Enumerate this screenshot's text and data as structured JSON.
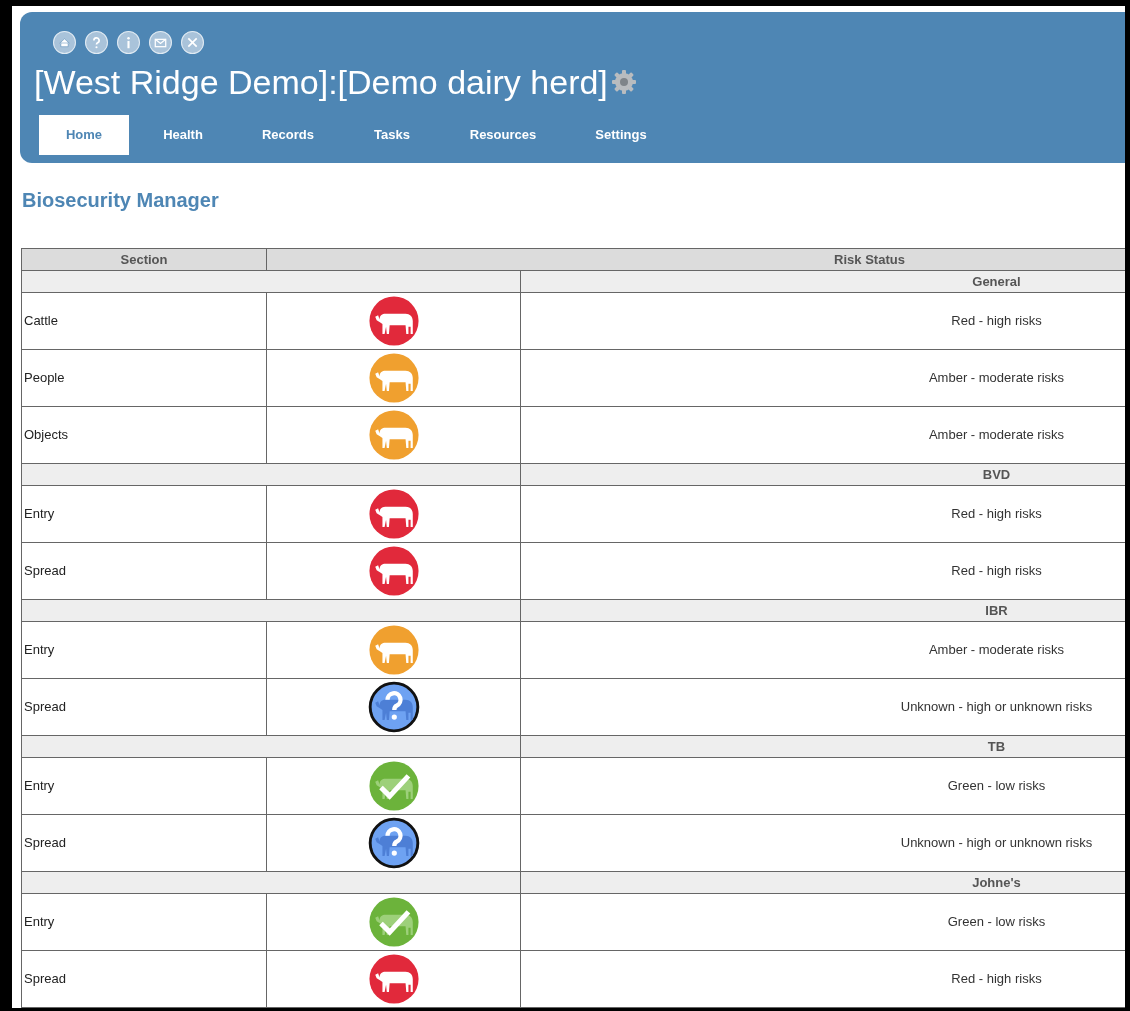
{
  "header": {
    "title": "[West Ridge Demo]:[Demo dairy herd]",
    "tabs": [
      {
        "label": "Home",
        "selected": true
      },
      {
        "label": "Health",
        "selected": false
      },
      {
        "label": "Records",
        "selected": false
      },
      {
        "label": "Tasks",
        "selected": false
      },
      {
        "label": "Resources",
        "selected": false
      },
      {
        "label": "Settings",
        "selected": false
      }
    ]
  },
  "page_title": "Biosecurity Manager",
  "table": {
    "columns": [
      "Section",
      "Risk Status"
    ],
    "groups": [
      {
        "title": "General",
        "rows": [
          {
            "section": "Cattle",
            "kind": "red",
            "status": "Red - high risks"
          },
          {
            "section": "People",
            "kind": "amber",
            "status": "Amber - moderate risks"
          },
          {
            "section": "Objects",
            "kind": "amber",
            "status": "Amber - moderate risks"
          }
        ]
      },
      {
        "title": "BVD",
        "rows": [
          {
            "section": "Entry",
            "kind": "red",
            "status": "Red - high risks"
          },
          {
            "section": "Spread",
            "kind": "red",
            "status": "Red - high risks"
          }
        ]
      },
      {
        "title": "IBR",
        "rows": [
          {
            "section": "Entry",
            "kind": "amber",
            "status": "Amber - moderate risks"
          },
          {
            "section": "Spread",
            "kind": "unknown",
            "status": "Unknown - high or unknown risks"
          }
        ]
      },
      {
        "title": "TB",
        "rows": [
          {
            "section": "Entry",
            "kind": "green",
            "status": "Green - low risks"
          },
          {
            "section": "Spread",
            "kind": "unknown",
            "status": "Unknown - high or unknown risks"
          }
        ]
      },
      {
        "title": "Johne's",
        "rows": [
          {
            "section": "Entry",
            "kind": "green",
            "status": "Green - low risks"
          },
          {
            "section": "Spread",
            "kind": "red",
            "status": "Red - high risks"
          }
        ]
      }
    ]
  }
}
